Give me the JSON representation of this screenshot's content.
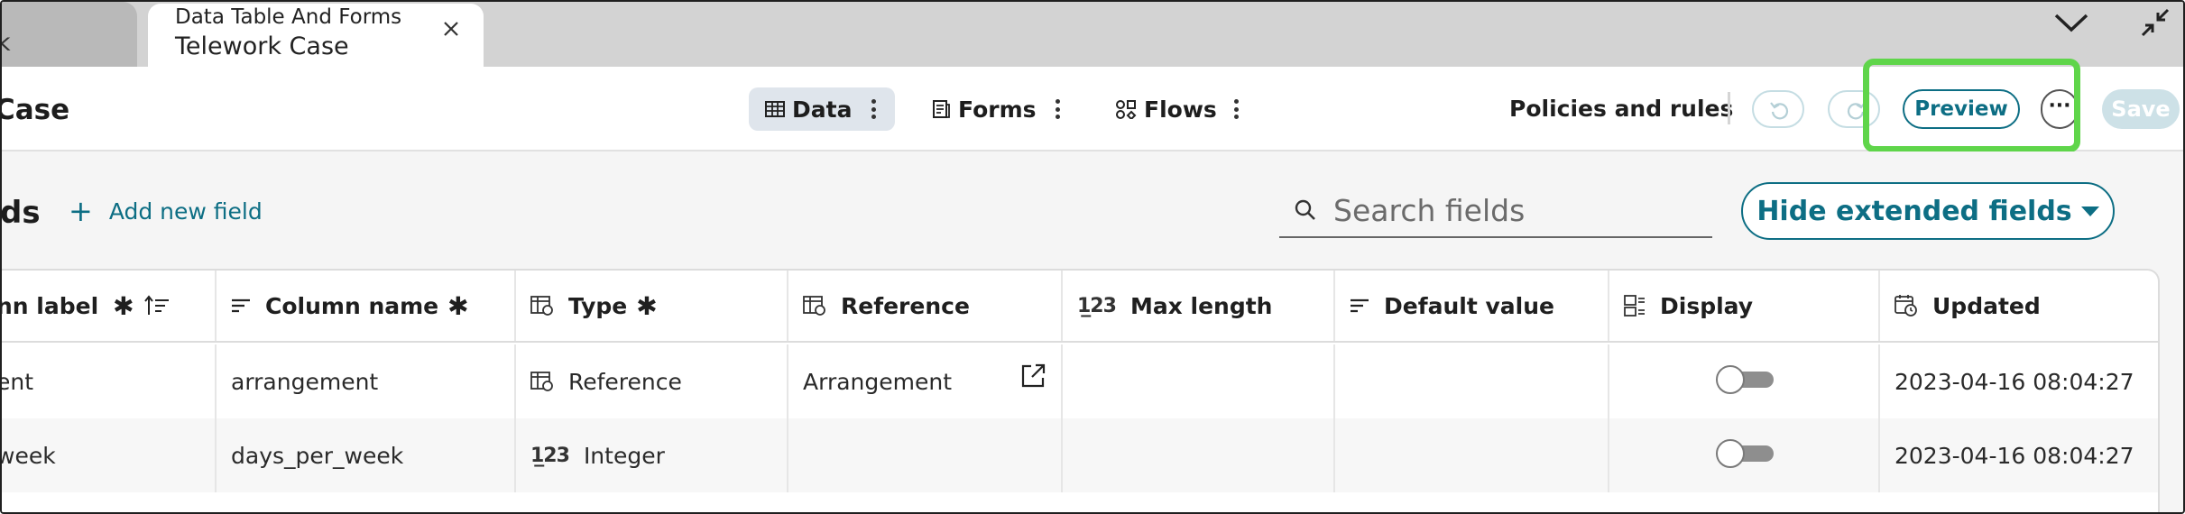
{
  "tabs": {
    "previous_label": "k",
    "active_title": "Data Table And Forms",
    "active_subtitle": "Telework Case"
  },
  "toolbar": {
    "page_title": "Case",
    "views": [
      {
        "label": "Data",
        "icon": "table-icon",
        "active": true
      },
      {
        "label": "Forms",
        "icon": "forms-icon",
        "active": false
      },
      {
        "label": "Flows",
        "icon": "flows-icon",
        "active": false
      }
    ],
    "policies_label": "Policies and rules",
    "undo_icon": "undo-icon",
    "redo_icon": "redo-icon",
    "preview_label": "Preview",
    "more_label": "···",
    "save_label": "Save"
  },
  "fields": {
    "section_title": "ds",
    "add_field_label": "Add new field",
    "search_placeholder": "Search fields",
    "hide_extended_label": "Hide extended fields"
  },
  "table": {
    "columns": [
      {
        "label": "nn label",
        "required": "✱",
        "icon": "sort-icon"
      },
      {
        "label": "Column name",
        "required": "✱",
        "icon": "text-lines-icon"
      },
      {
        "label": "Type",
        "required": "✱",
        "icon": "type-icon"
      },
      {
        "label": "Reference",
        "icon": "reference-icon"
      },
      {
        "label": "Max length",
        "icon": "number-icon"
      },
      {
        "label": "Default value",
        "icon": "text-lines-icon"
      },
      {
        "label": "Display",
        "icon": "display-icon"
      },
      {
        "label": "Updated",
        "icon": "calendar-clock-icon"
      }
    ],
    "rows": [
      {
        "label": "ent",
        "name": "arrangement",
        "type": "Reference",
        "reference": "Arrangement",
        "max_length": "",
        "default_value": "",
        "display": false,
        "updated": "2023-04-16 08:04:27"
      },
      {
        "label": "week",
        "name": "days_per_week",
        "type": "Integer",
        "reference": "",
        "max_length": "",
        "default_value": "",
        "display": false,
        "updated": "2023-04-16 08:04:27"
      }
    ]
  },
  "colors": {
    "accent": "#0d6e84",
    "highlight": "#5fd54a",
    "active_view_bg": "#dfe5ec"
  }
}
